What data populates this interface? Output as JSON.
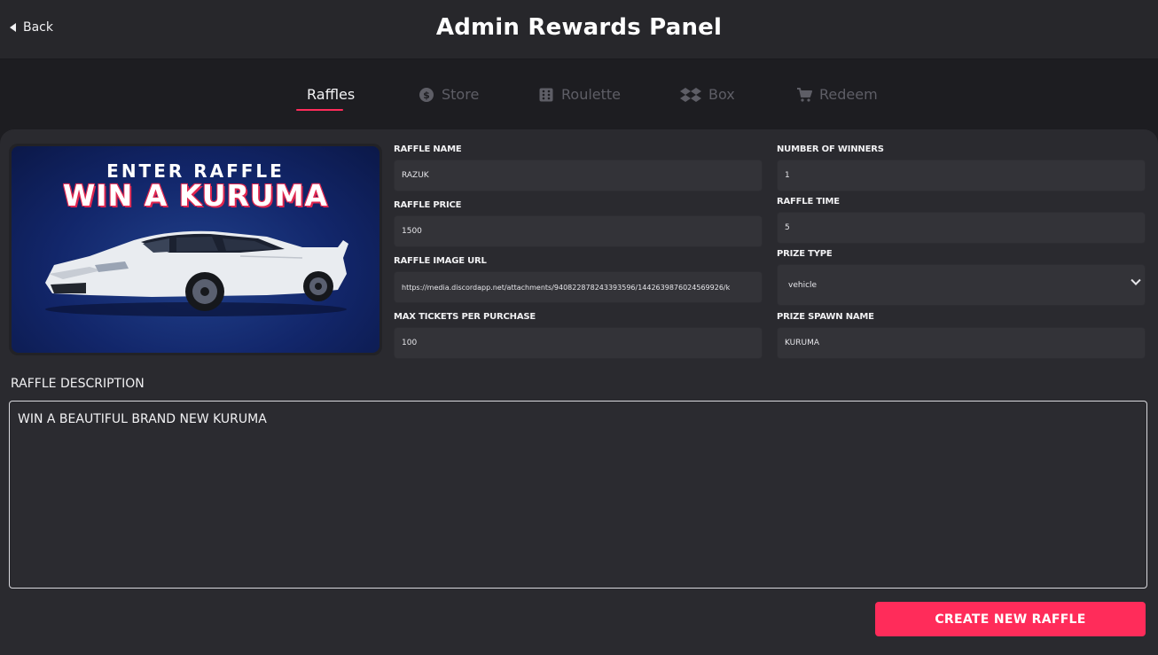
{
  "header": {
    "back_label": "Back",
    "title": "Admin Rewards Panel"
  },
  "tabs": [
    {
      "label": "Raffles",
      "icon": "none",
      "active": true
    },
    {
      "label": "Store",
      "icon": "dollar-coin-icon",
      "active": false
    },
    {
      "label": "Roulette",
      "icon": "dice-icon",
      "active": false
    },
    {
      "label": "Box",
      "icon": "dropbox-icon",
      "active": false
    },
    {
      "label": "Redeem",
      "icon": "cart-icon",
      "active": false
    }
  ],
  "raffle_image": {
    "line1": "ENTER RAFFLE",
    "line2": "WIN A KURUMA"
  },
  "form": {
    "raffle_name": {
      "label": "RAFFLE NAME",
      "value": "RAZUK"
    },
    "raffle_price": {
      "label": "RAFFLE PRICE",
      "value": "1500"
    },
    "raffle_image_url": {
      "label": "RAFFLE IMAGE URL",
      "value": "https://media.discordapp.net/attachments/940822878243393596/1442639876024569926/k"
    },
    "max_tickets": {
      "label": "MAX TICKETS PER PURCHASE",
      "value": "100"
    },
    "number_of_winners": {
      "label": "NUMBER OF WINNERS",
      "value": "1"
    },
    "raffle_time": {
      "label": "RAFFLE TIME",
      "value": "5"
    },
    "prize_type": {
      "label": "PRIZE TYPE",
      "value": "vehicle"
    },
    "prize_spawn_name": {
      "label": "PRIZE SPAWN NAME",
      "value": "KURUMA"
    }
  },
  "description": {
    "label": "RAFFLE DESCRIPTION",
    "value": "WIN A BEAUTIFUL BRAND NEW KURUMA"
  },
  "create_button_label": "CREATE NEW RAFFLE",
  "colors": {
    "accent": "#ff2c5a",
    "background": "#1d1d21",
    "panel": "#2a2a2f"
  }
}
